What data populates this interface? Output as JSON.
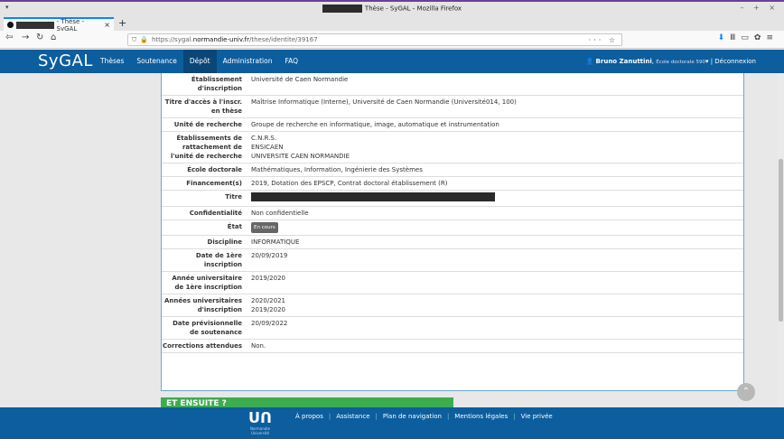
{
  "window": {
    "title": "Thèse - SyGAL - Mozilla Firefox",
    "controls": "– + ×"
  },
  "tab": {
    "title": "- Thèse - SyGAL",
    "close": "×",
    "new_tab": "+"
  },
  "navbar": {
    "url_prefix": "https://sygal.",
    "url_domain": "normandie-univ.fr",
    "url_path": "/these/identite/39167",
    "page_actions": "··· ☆"
  },
  "app": {
    "brand": "SyGAL",
    "nav": [
      "Thèses",
      "Soutenance",
      "Dépôt",
      "Administration",
      "FAQ"
    ],
    "active_nav": "Dépôt",
    "user": {
      "name": "Bruno Zanuttini",
      "role": "École doctorale 590",
      "logout": "Déconnexion"
    }
  },
  "rows": [
    {
      "label": "Établissement d'inscription",
      "value": "Université de Caen Normandie"
    },
    {
      "label": "Titre d'accès à l'inscr. en thèse",
      "value": "Maîtrise Informatique (Interne), Université de Caen Normandie (Université014, 100)"
    },
    {
      "label": "Unité de recherche",
      "value": "Groupe de recherche en informatique, image, automatique et instrumentation"
    },
    {
      "label": "Établissements de rattachement de l'unité de recherche",
      "value": "C.N.R.S.\nENSICAEN\nUNIVERSITE CAEN NORMANDIE"
    },
    {
      "label": "École doctorale",
      "value": "Mathématiques, Information, Ingénierie des Systèmes"
    },
    {
      "label": "Financement(s)",
      "value": "2019, Dotation des EPSCP, Contrat doctoral établissement (R)"
    },
    {
      "label": "Titre",
      "value": ""
    },
    {
      "label": "Confidentialité",
      "value": "Non confidentielle"
    },
    {
      "label": "État",
      "value": "En cours"
    },
    {
      "label": "Discipline",
      "value": "INFORMATIQUE"
    },
    {
      "label": "Date de 1ère inscription",
      "value": "20/09/2019"
    },
    {
      "label": "Année universitaire de 1ère inscription",
      "value": "2019/2020"
    },
    {
      "label": "Années universitaires d'inscription",
      "value": "2020/2021\n2019/2020"
    },
    {
      "label": "Date prévisionnelle de soutenance",
      "value": "20/09/2022"
    },
    {
      "label": "Corrections attendues",
      "value": "Non."
    }
  ],
  "section_next": "ET ENSUITE ?",
  "footer": {
    "logo_caption": "Normandie Université",
    "links": [
      "À propos",
      "Assistance",
      "Plan de navigation",
      "Mentions légales",
      "Vie privée"
    ]
  }
}
